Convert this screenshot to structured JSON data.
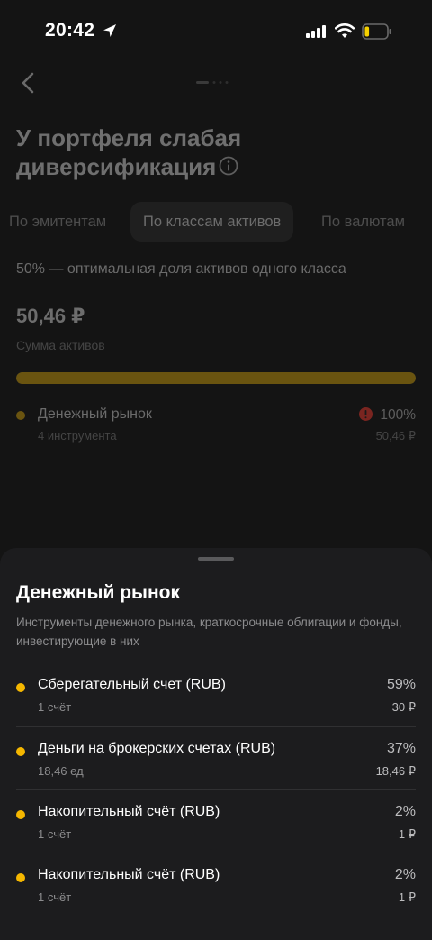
{
  "status_bar": {
    "time": "20:42",
    "battery_level": 0.2,
    "battery_color": "#f5d000"
  },
  "header": {
    "title": "У портфеля слабая диверсификация"
  },
  "tabs": [
    {
      "label": "По эмитентам"
    },
    {
      "label": "По классам активов",
      "active": true
    },
    {
      "label": "По валютам"
    }
  ],
  "summary": {
    "optimal_note": "50% — оптимальная доля активов одного класса",
    "total_sum": "50,46 ₽",
    "total_label": "Сумма активов",
    "fill_fraction": 1.0
  },
  "asset_class": {
    "name": "Денежный рынок",
    "count": "4 инструмента",
    "percent": "100%",
    "amount": "50,46 ₽"
  },
  "sheet": {
    "title": "Денежный рынок",
    "description": "Инструменты денежного рынка, краткосрочные облигации и фонды, инвестирующие в них",
    "items": [
      {
        "name": "Сберегательный счет (RUB)",
        "sub": "1 счёт",
        "percent": "59%",
        "amount": "30 ₽"
      },
      {
        "name": "Деньги на брокерских счетах (RUB)",
        "sub": "18,46 ед",
        "percent": "37%",
        "amount": "18,46 ₽"
      },
      {
        "name": "Накопительный счёт (RUB)",
        "sub": "1 счёт",
        "percent": "2%",
        "amount": "1 ₽"
      },
      {
        "name": "Накопительный счёт (RUB)",
        "sub": "1 счёт",
        "percent": "2%",
        "amount": "1 ₽"
      }
    ]
  },
  "colors": {
    "accent": "#f5b700",
    "warning": "#e0443a"
  }
}
